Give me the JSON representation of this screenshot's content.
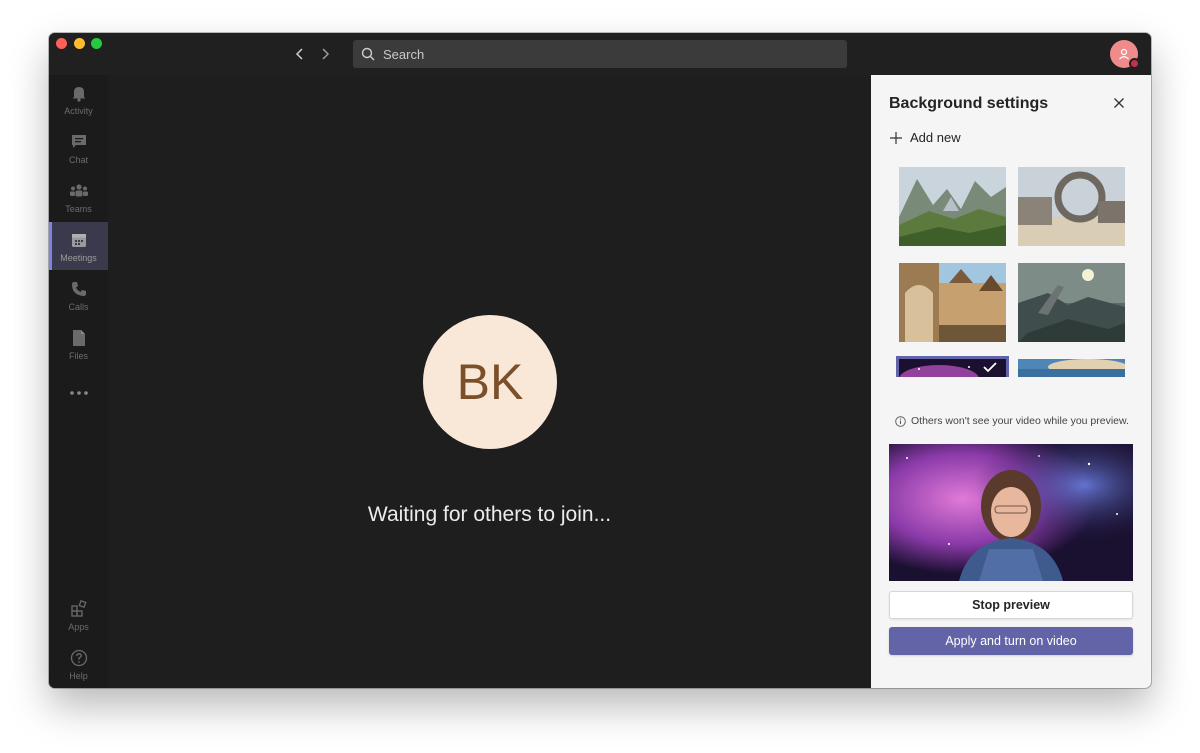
{
  "topbar": {
    "search_placeholder": "Search"
  },
  "rail": {
    "items": [
      {
        "label": "Activity",
        "icon": "bell-icon"
      },
      {
        "label": "Chat",
        "icon": "chat-icon"
      },
      {
        "label": "Teams",
        "icon": "teams-icon"
      },
      {
        "label": "Meetings",
        "icon": "calendar-icon",
        "active": true
      },
      {
        "label": "Calls",
        "icon": "phone-icon"
      },
      {
        "label": "Files",
        "icon": "file-icon"
      }
    ],
    "more": "...",
    "bottom": [
      {
        "label": "Apps",
        "icon": "apps-icon"
      },
      {
        "label": "Help",
        "icon": "help-icon"
      }
    ]
  },
  "stage": {
    "initials": "BK",
    "waiting_text": "Waiting for others to join..."
  },
  "panel": {
    "title": "Background settings",
    "add_new": "Add new",
    "preview_note": "Others won't see your video while you preview.",
    "stop_preview": "Stop preview",
    "apply": "Apply and turn on video"
  },
  "colors": {
    "accent": "#6264a7",
    "panel_bg": "#f5f5f5",
    "stage_bg": "#1e1e1e",
    "avatar_bg": "#f9e8d8",
    "avatar_text": "#7a4f2a"
  }
}
